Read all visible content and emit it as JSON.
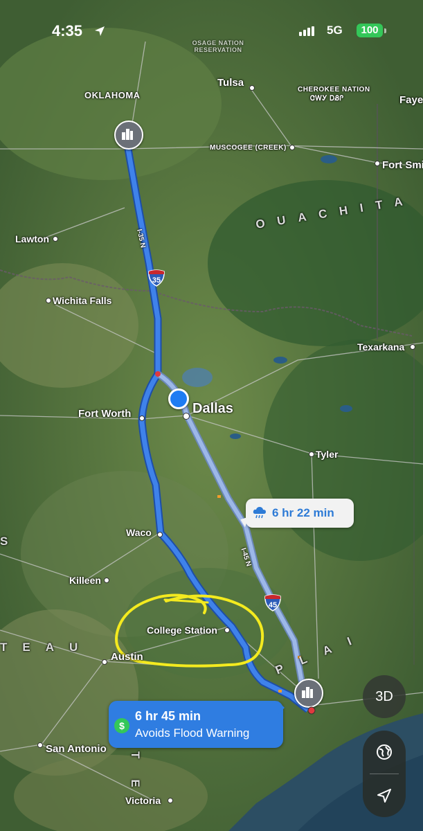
{
  "status_bar": {
    "time": "4:35",
    "network": "5G",
    "battery": "100"
  },
  "map_labels": {
    "osage": "OSAGE NATION RESERVATION",
    "oklahoma": "OKLAHOMA",
    "tulsa": "Tulsa",
    "cherokee": "CHEROKEE NATION",
    "cherokee_script": "ᏣᎳᎩ ᎠᏰᎵ",
    "fayetteville": "Faye",
    "muscogee": "MUSCOGEE (CREEK)",
    "fort_smith": "Fort Smi",
    "lawton": "Lawton",
    "ouachita": "OUACHITA M",
    "wichita_falls": "Wichita Falls",
    "texarkana": "Texarkana",
    "dallas": "Dallas",
    "fort_worth": "Fort Worth",
    "tyler": "Tyler",
    "waco": "Waco",
    "killeen": "Killeen",
    "college_station": "College Station",
    "austin": "Austin",
    "plateau": "TEAU",
    "plains": "PLAI",
    "san_antonio": "San Antonio",
    "victoria": "Victoria",
    "texas": "TE",
    "s_left": "S"
  },
  "shields": {
    "i35": "35",
    "i45": "45"
  },
  "road_labels": {
    "i35n": "I-35 N",
    "i45n": "I-45 N"
  },
  "routes": {
    "alternate": {
      "eta": "6 hr 22 min",
      "icon": "rain-cloud-icon"
    },
    "main": {
      "eta": "6 hr 45 min",
      "note": "Avoids Flood Warning",
      "icon": "dollar-icon"
    }
  },
  "controls": {
    "view_mode": "3D"
  },
  "colors": {
    "route_main": "#3f82ea",
    "route_alt": "#9db8e8",
    "annotation": "#f4ea1f"
  }
}
